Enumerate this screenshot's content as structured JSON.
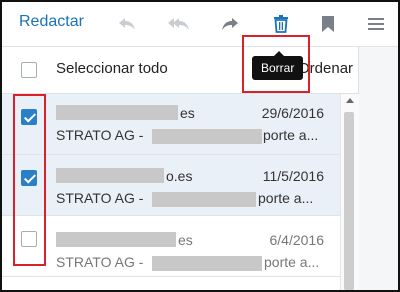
{
  "toolbar": {
    "compose_label": "Redactar",
    "icons": [
      "reply-icon",
      "reply-all-icon",
      "forward-icon",
      "trash-icon",
      "bookmark-icon",
      "menu-icon"
    ],
    "tooltip": "Borrar"
  },
  "list_header": {
    "select_all_label": "Seleccionar todo",
    "sort_label": "Ordenar por"
  },
  "messages": [
    {
      "sender_suffix": "es",
      "date": "29/6/2016",
      "subject_prefix": "STRATO AG - ",
      "subject_tail": "porte a...",
      "checked": true,
      "unread": true
    },
    {
      "sender_suffix": "o.es",
      "date": "11/5/2016",
      "subject_prefix": "STRATO AG - ",
      "subject_tail": "porte a...",
      "checked": true,
      "unread": true
    },
    {
      "sender_suffix": "es",
      "date": "6/4/2016",
      "subject_prefix": "STRATO AG - ",
      "subject_tail": "porte a...",
      "checked": false,
      "unread": false
    }
  ],
  "colors": {
    "accent": "#1a73b8",
    "checkbox_checked": "#2a7fc9",
    "highlight": "#d9212b",
    "selected_row": "#eaf0f8"
  }
}
